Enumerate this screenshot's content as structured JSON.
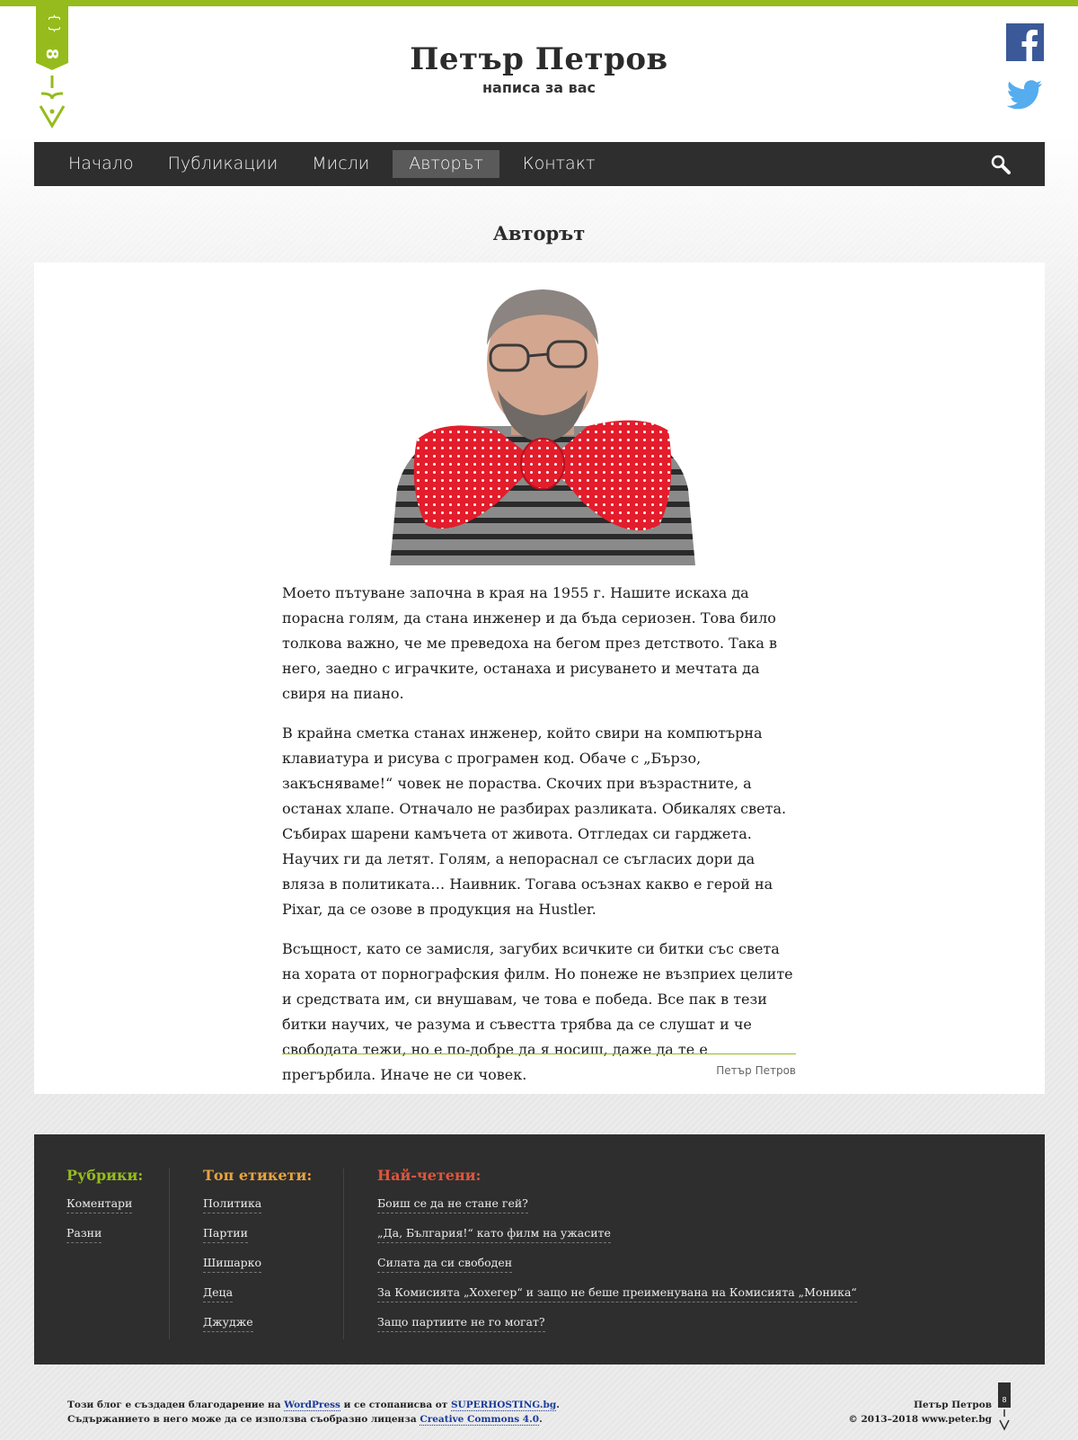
{
  "header": {
    "title": "Петър Петров",
    "subtitle": "написа за вас",
    "logo_icon": "curly-brace-pen-logo",
    "social": [
      {
        "name": "facebook",
        "color": "#3b5998"
      },
      {
        "name": "twitter",
        "color": "#55acee"
      }
    ]
  },
  "nav": {
    "items": [
      {
        "label": "Начало",
        "active": false
      },
      {
        "label": "Публикации",
        "active": false
      },
      {
        "label": "Мисли",
        "active": false
      },
      {
        "label": "Авторът",
        "active": true
      },
      {
        "label": "Контакт",
        "active": false
      }
    ],
    "search_icon": "search-icon"
  },
  "page": {
    "heading": "Авторът",
    "paragraphs": [
      "Моето пътуване започна в края на 1955 г. Нашите искаха да порасна голям, да стана инженер и да бъда сериозен. Това било толкова важно, че ме преведоха на бегом през детството. Така в него, заедно с играчките, останаха и рисуването и мечтата да свиря на пиано.",
      "В крайна сметка станах инженер, който свири на компютърна клавиатура и рисува с програмен код. Обаче с „Бързо, закъсняваме!“ човек не пораства. Скочих при възрастните, а останах хлапе. Отначало не разбирах разликата. Обикалях света. Събирах шарени камъчета от живота. Отгледах си гарджета. Научих ги да летят. Голям, а непораснал се съгласих дори да вляза в политиката… Наивник. Тогава осъзнах какво е герой на Pixar, да се озове в продукция на Hustler.",
      "Всъщност, като се замисля, загубих всичките си битки със света на хората от порнографския филм. Но понеже не възприех целите и средствата им, си внушавам, че това е победа. Все пак в тези битки научих, че разума и съвестта трябва да се слушат и че свободата тежи, но е по-добре да я носиш, даже да те е прегърбила. Иначе не си човек."
    ],
    "signature": "Петър Петров"
  },
  "footer": {
    "categories": {
      "title": "Рубрики:",
      "items": [
        "Коментари",
        "Разни"
      ]
    },
    "tags": {
      "title": "Топ етикети:",
      "items": [
        "Политика",
        "Партии",
        "Шишарко",
        "Деца",
        "Джудже"
      ]
    },
    "popular": {
      "title": "Най-четени:",
      "items": [
        "Боиш се да не стане гей?",
        "„Да, България!“ като филм на ужасите",
        "Силата да си свободен",
        "За Комисията „Хохегер“ и защо не беше преименувана на Комисията „Моника“",
        "Защо партиите не го могат?"
      ]
    }
  },
  "bottom": {
    "line1_prefix": "Този блог е създаден благодарение на ",
    "line1_link1": "WordPress",
    "line1_mid": " и се стопанисва от ",
    "line1_link2": "SUPERHOSTING.bg",
    "line1_suffix": ".",
    "line2_prefix": "Съдържанието в него може да се използва съобразно лиценза ",
    "line2_link": "Creative Commons 4.0",
    "line2_suffix": ".",
    "right_name": "Петър Петров",
    "right_copy": "© 2013–2018 www.peter.bg"
  },
  "colors": {
    "accent_green": "#95bc1c",
    "nav_bg": "#2e2e2e",
    "tags_orange": "#e8a33d",
    "popular_red": "#e0553c"
  }
}
